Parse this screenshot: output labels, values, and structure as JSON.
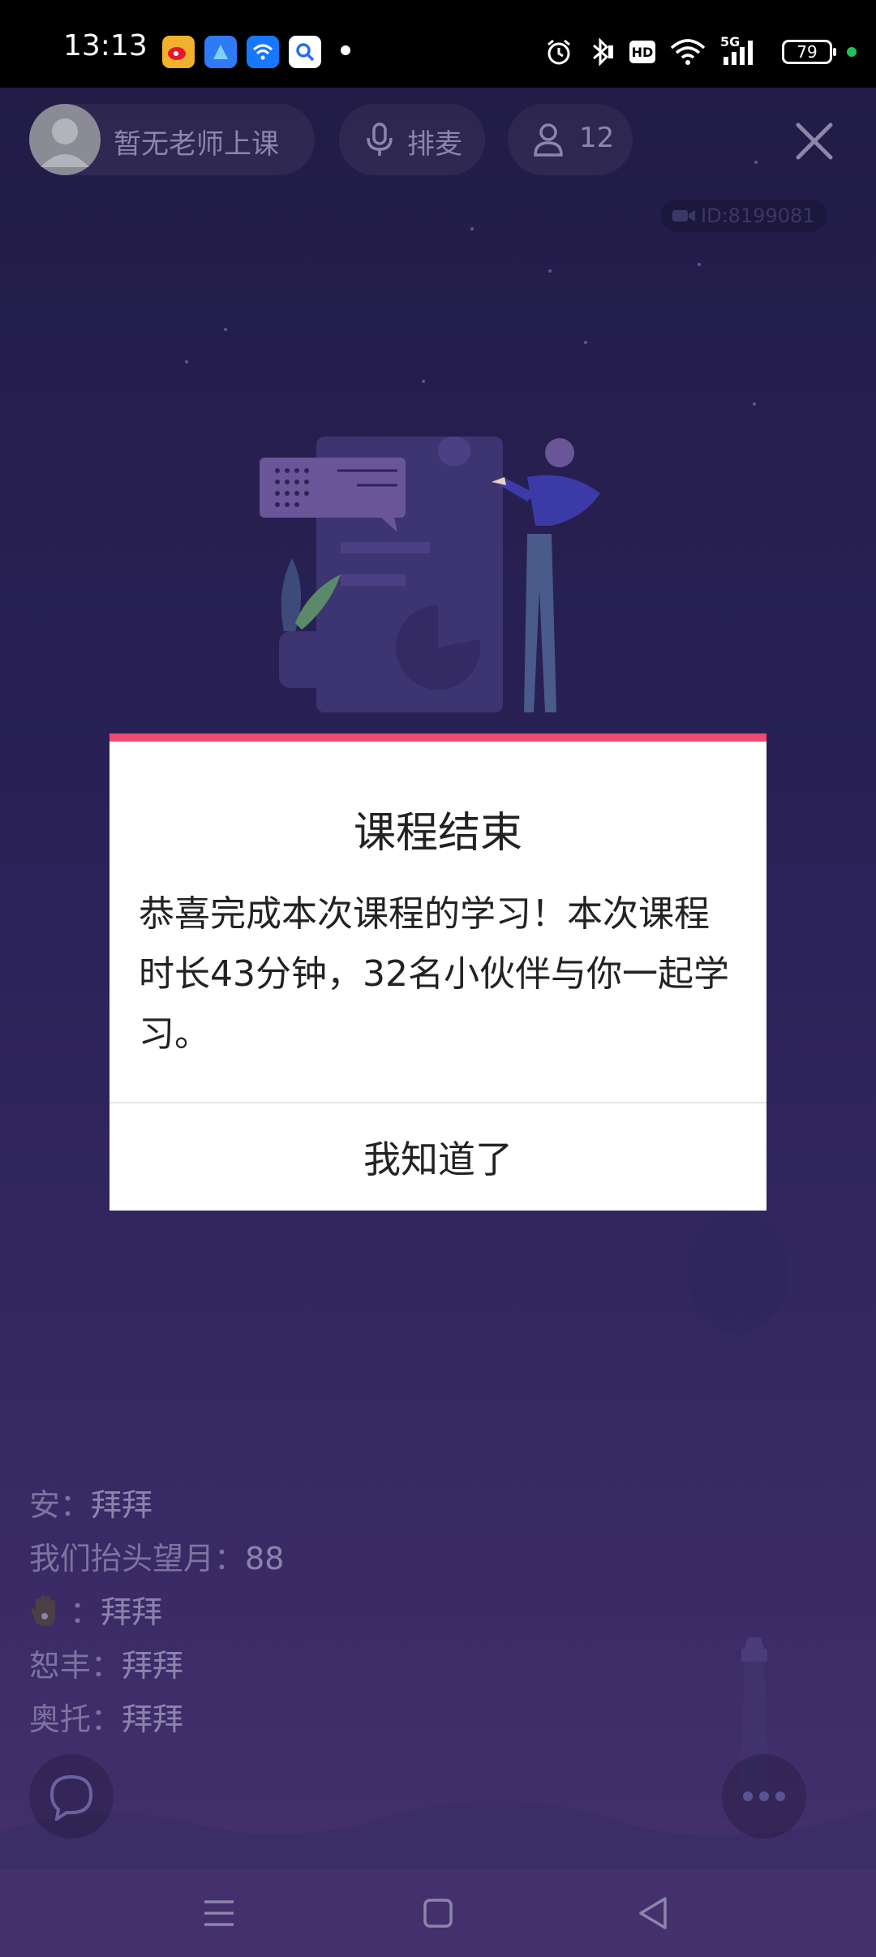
{
  "status_bar": {
    "time": "13:13",
    "battery_level": "79",
    "app_icons": [
      "weibo-icon",
      "browser-icon",
      "wifi-app-icon",
      "search-app-icon"
    ],
    "indicators": [
      "alarm-icon",
      "bluetooth-icon",
      "hd-icon",
      "wifi-icon",
      "signal-5g-icon"
    ],
    "network_label": "5G",
    "hd_label": "HD"
  },
  "header": {
    "teacher_status": "暂无老师上课",
    "mic_queue_label": "排麦",
    "online_count": "12",
    "room_id": "ID:8199081"
  },
  "chat": {
    "messages": [
      {
        "name": "安：",
        "text": "拜拜"
      },
      {
        "name": "我们抬头望月：",
        "text": "88"
      },
      {
        "name": "：",
        "text": "拜拜"
      },
      {
        "name": "恕丰：",
        "text": "拜拜"
      },
      {
        "name": "奥托：",
        "text": "拜拜"
      }
    ]
  },
  "modal": {
    "title": "课程结束",
    "body": "恭喜完成本次课程的学习！本次课程时长43分钟，32名小伙伴与你一起学习。",
    "confirm_label": "我知道了"
  },
  "colors": {
    "modal_accent": "#f04a73",
    "background": "#241f47"
  }
}
